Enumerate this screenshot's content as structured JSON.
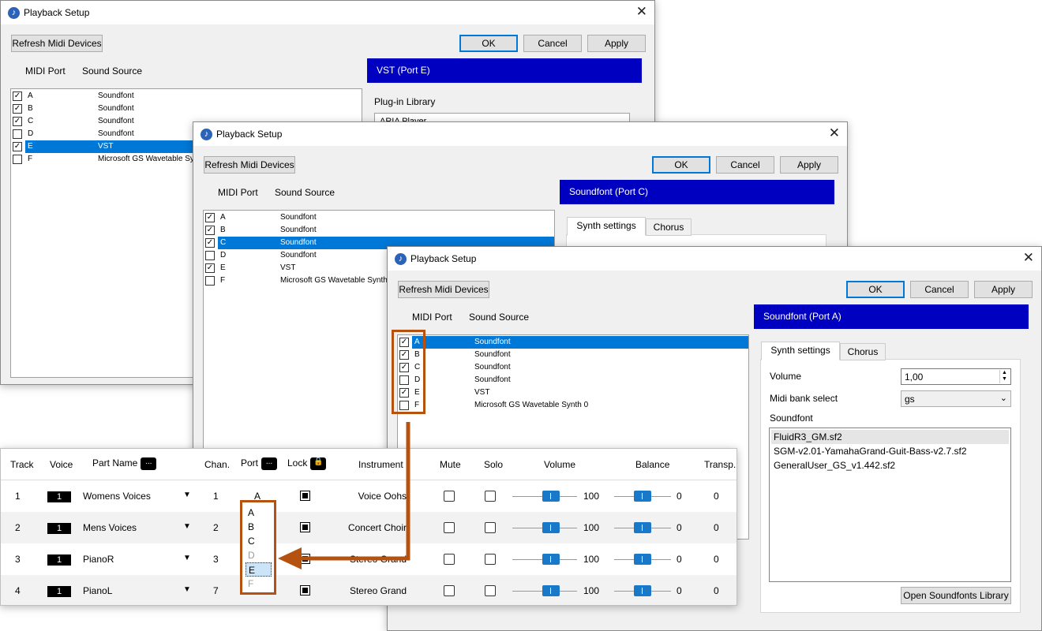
{
  "dialog1": {
    "title": "Playback Setup",
    "refresh": "Refresh Midi Devices",
    "ok": "OK",
    "cancel": "Cancel",
    "apply": "Apply",
    "col_port": "MIDI Port",
    "col_source": "Sound Source",
    "banner": "VST (Port E)",
    "plugin_label": "Plug-in Library",
    "plugin_value": "ARIA Player",
    "ports": [
      {
        "port": "A",
        "source": "Soundfont",
        "checked": true
      },
      {
        "port": "B",
        "source": "Soundfont",
        "checked": true
      },
      {
        "port": "C",
        "source": "Soundfont",
        "checked": true
      },
      {
        "port": "D",
        "source": "Soundfont",
        "checked": false
      },
      {
        "port": "E",
        "source": "VST",
        "checked": true,
        "selected": true
      },
      {
        "port": "F",
        "source": "Microsoft GS Wavetable Synth 0",
        "checked": false
      }
    ]
  },
  "dialog2": {
    "title": "Playback Setup",
    "refresh": "Refresh Midi Devices",
    "ok": "OK",
    "cancel": "Cancel",
    "apply": "Apply",
    "col_port": "MIDI Port",
    "col_source": "Sound Source",
    "banner": "Soundfont (Port C)",
    "tabs": [
      "Synth settings",
      "Chorus"
    ],
    "ports": [
      {
        "port": "A",
        "source": "Soundfont",
        "checked": true
      },
      {
        "port": "B",
        "source": "Soundfont",
        "checked": true
      },
      {
        "port": "C",
        "source": "Soundfont",
        "checked": true,
        "selected": true
      },
      {
        "port": "D",
        "source": "Soundfont",
        "checked": false
      },
      {
        "port": "E",
        "source": "VST",
        "checked": true
      },
      {
        "port": "F",
        "source": "Microsoft GS Wavetable Synth 0",
        "checked": false
      }
    ]
  },
  "dialog3": {
    "title": "Playback Setup",
    "refresh": "Refresh Midi Devices",
    "ok": "OK",
    "cancel": "Cancel",
    "apply": "Apply",
    "col_port": "MIDI Port",
    "col_source": "Sound Source",
    "banner": "Soundfont (Port A)",
    "tabs": [
      "Synth settings",
      "Chorus"
    ],
    "volume_label": "Volume",
    "volume_value": "1,00",
    "bank_label": "Midi bank select",
    "bank_value": "gs",
    "soundfont_label": "Soundfont",
    "soundfonts": [
      "FluidR3_GM.sf2",
      "SGM-v2.01-YamahaGrand-Guit-Bass-v2.7.sf2",
      "GeneralUser_GS_v1.442.sf2"
    ],
    "open_library": "Open Soundfonts Library",
    "ports": [
      {
        "port": "A",
        "source": "Soundfont",
        "checked": true,
        "selected": true
      },
      {
        "port": "B",
        "source": "Soundfont",
        "checked": true
      },
      {
        "port": "C",
        "source": "Soundfont",
        "checked": true
      },
      {
        "port": "D",
        "source": "Soundfont",
        "checked": false
      },
      {
        "port": "E",
        "source": "VST",
        "checked": true
      },
      {
        "port": "F",
        "source": "Microsoft GS Wavetable Synth 0",
        "checked": false
      }
    ]
  },
  "tracks_table": {
    "headers": {
      "track": "Track",
      "voice": "Voice",
      "part": "Part Name",
      "chan": "Chan.",
      "port": "Port",
      "lock": "Lock",
      "instrument": "Instrument",
      "mute": "Mute",
      "solo": "Solo",
      "volume": "Volume",
      "balance": "Balance",
      "transp": "Transp."
    },
    "header_more": "...",
    "rows": [
      {
        "track": "1",
        "voice": "1",
        "part": "Womens Voices",
        "chan": "1",
        "port": "A",
        "instrument": "Voice Oohs",
        "volume": "100",
        "balance": "0",
        "transp": "0"
      },
      {
        "track": "2",
        "voice": "1",
        "part": "Mens Voices",
        "chan": "2",
        "port": "",
        "instrument": "Concert Choir",
        "volume": "100",
        "balance": "0",
        "transp": "0"
      },
      {
        "track": "3",
        "voice": "1",
        "part": "PianoR",
        "chan": "3",
        "port": "",
        "instrument": "Stereo Grand",
        "volume": "100",
        "balance": "0",
        "transp": "0"
      },
      {
        "track": "4",
        "voice": "1",
        "part": "PianoL",
        "chan": "7",
        "port": "",
        "instrument": "Stereo Grand",
        "volume": "100",
        "balance": "0",
        "transp": "0"
      }
    ]
  },
  "port_dropdown": {
    "options": [
      "A",
      "B",
      "C",
      "D",
      "E",
      "F"
    ],
    "selected": "E",
    "disabled": [
      "D",
      "F"
    ]
  },
  "colors": {
    "banner": "#0000c0",
    "selection": "#0078d7",
    "highlight": "#b5520f"
  }
}
